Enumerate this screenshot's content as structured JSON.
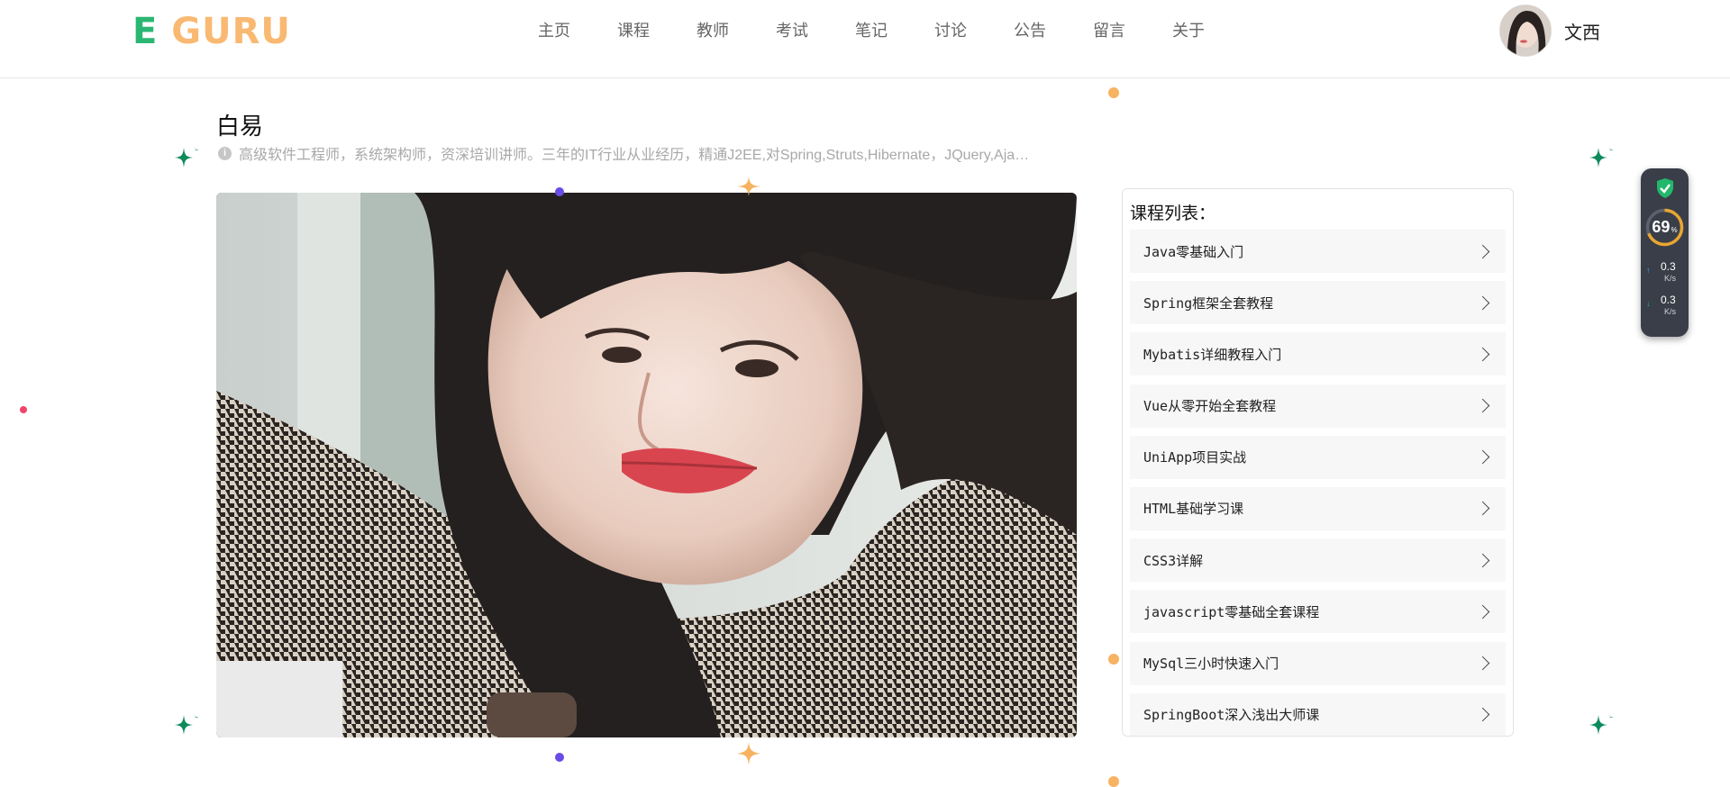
{
  "header": {
    "logo_e": "E",
    "logo_rest": "GURU",
    "nav": [
      "主页",
      "课程",
      "教师",
      "考试",
      "笔记",
      "讨论",
      "公告",
      "留言",
      "关于"
    ],
    "user_name": "文西"
  },
  "teacher": {
    "name": "白易",
    "description": "高级软件工程师，系统架构师，资深培训讲师。三年的IT行业从业经历，精通J2EE,对Spring,Struts,Hibernate，JQuery,Aja…",
    "info_icon": "i"
  },
  "courses": {
    "title": "课程列表：",
    "items": [
      "Java零基础入门",
      "Spring框架全套教程",
      "Mybatis详细教程入门",
      "Vue从零开始全套教程",
      "UniApp项目实战",
      "HTML基础学习课",
      "CSS3详解",
      "javascript零基础全套课程",
      "MySql三小时快速入门",
      "SpringBoot深入浅出大师课"
    ]
  },
  "speed_widget": {
    "percent": "69",
    "percent_unit": "%",
    "upload_value": "0.3",
    "upload_unit": "K/s",
    "download_value": "0.3",
    "download_unit": "K/s",
    "level": 0.69
  },
  "colors": {
    "logo_e": "#2bb673",
    "logo_guru": "#f9b972",
    "sparkle_green": "#0c8a5a",
    "sparkle_orange": "#f7b262",
    "dot_purple": "#6a4be8",
    "dot_red": "#f0456a",
    "widget_bg": "#3a3e48"
  },
  "icons": {
    "shield": "shield-check-icon",
    "chevron": "chevron-right-icon",
    "upload": "arrow-up-icon",
    "download": "arrow-down-icon",
    "info": "info-icon",
    "sparkle": "sparkle-icon"
  }
}
